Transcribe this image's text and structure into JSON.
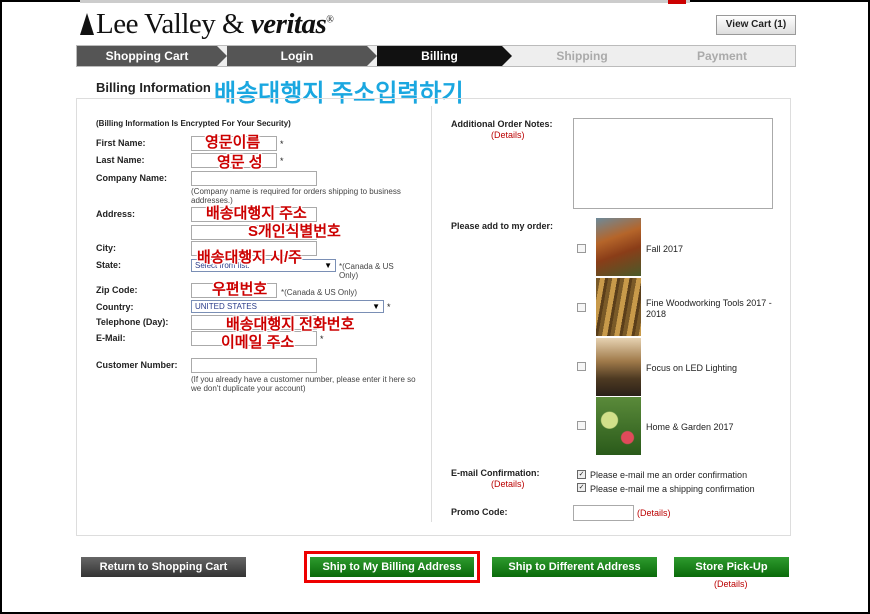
{
  "header": {
    "logo_part1": "Lee Valley",
    "logo_amp": " & ",
    "logo_part2": "veritas",
    "logo_reg": "®",
    "view_cart": "View Cart (1)"
  },
  "steps": [
    "Shopping Cart",
    "Login",
    "Billing",
    "Shipping",
    "Payment"
  ],
  "billing": {
    "title": "Billing Information",
    "korean_title": "배송대행지 주소입력하기",
    "encrypted_note": "(Billing Information Is Encrypted For Your Security)",
    "first_name_label": "First Name:",
    "last_name_label": "Last Name:",
    "company_label": "Company Name:",
    "company_note": "(Company name is required for orders shipping to business addresses.)",
    "address_label": "Address:",
    "city_label": "City:",
    "state_label": "State:",
    "state_value": "Select from list:",
    "state_note": "*(Canada & US Only)",
    "zip_label": "Zip Code:",
    "zip_note": "*(Canada & US Only)",
    "country_label": "Country:",
    "country_value": "UNITED STATES",
    "phone_label": "Telephone (Day):",
    "email_label": "E-Mail:",
    "customer_label": "Customer Number:",
    "customer_note": "(If you already have a customer number, please enter it here so we don't duplicate your account)",
    "required_mark": "*"
  },
  "annotations": {
    "first_name": "영문이름",
    "last_name": "영문 성",
    "address1": "배송대행지 주소",
    "address2": "S개인식별번호",
    "city_state": "배송대행지 시/주",
    "zip": "우편번호",
    "phone": "배송대행지 전화번호",
    "email": "이메일 주소"
  },
  "right": {
    "notes_label": "Additional Order Notes:",
    "details": "(Details)",
    "add_label": "Please add to my order:",
    "catalogs": [
      {
        "label": "Fall 2017"
      },
      {
        "label": "Fine Woodworking Tools 2017 - 2018"
      },
      {
        "label": "Focus on LED Lighting"
      },
      {
        "label": "Home & Garden 2017"
      }
    ],
    "email_conf_label": "E-mail Confirmation:",
    "email_conf_1": "Please e-mail me an order confirmation",
    "email_conf_2": "Please e-mail me a shipping confirmation",
    "promo_label": "Promo Code:",
    "promo_details": "(Details)"
  },
  "buttons": {
    "return": "Return to Shopping Cart",
    "ship_billing": "Ship to My Billing Address",
    "ship_different": "Ship to Different Address",
    "store_pickup": "Store Pick-Up",
    "store_details": "(Details)"
  }
}
